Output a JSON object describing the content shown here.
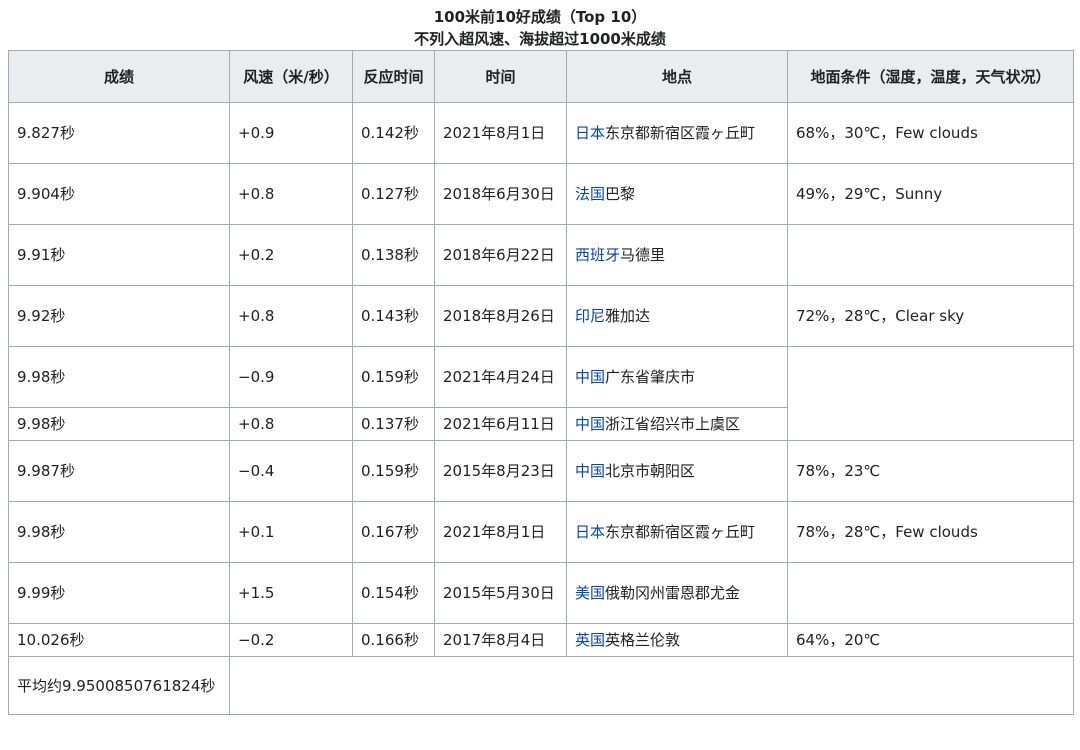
{
  "caption": {
    "line1": "100米前10好成绩（Top 10）",
    "line2": "不列入超风速、海拔超过1000米成绩"
  },
  "headers": {
    "score": "成绩",
    "wind": "风速（米/秒）",
    "reaction": "反应时间",
    "time": "时间",
    "location": "地点",
    "conditions": "地面条件（湿度，温度，天气状况）"
  },
  "rows": [
    {
      "score": "9.827秒",
      "wind": "+0.9",
      "reaction": "0.142秒",
      "date": "2021年8月1日",
      "country": "日本",
      "place": "东京都新宿区霞ヶ丘町",
      "cond": "68%，30℃，Few clouds"
    },
    {
      "score": "9.904秒",
      "wind": "+0.8",
      "reaction": "0.127秒",
      "date": "2018年6月30日",
      "country": "法国",
      "place": "巴黎",
      "cond": "49%，29℃，Sunny"
    },
    {
      "score": "9.91秒",
      "wind": "+0.2",
      "reaction": "0.138秒",
      "date": "2018年6月22日",
      "country": "西班牙",
      "place": "马德里",
      "cond": ""
    },
    {
      "score": "9.92秒",
      "wind": "+0.8",
      "reaction": "0.143秒",
      "date": "2018年8月26日",
      "country": "印尼",
      "place": "雅加达",
      "cond": "72%，28℃，Clear sky"
    },
    {
      "score": "9.98秒",
      "wind": "−0.9",
      "reaction": "0.159秒",
      "date": "2021年4月24日",
      "country": "中国",
      "place": "广东省肇庆市",
      "cond": ""
    },
    {
      "score": "9.98秒",
      "wind": "+0.8",
      "reaction": "0.137秒",
      "date": "2021年6月11日",
      "country": "中国",
      "place": "浙江省绍兴市上虞区"
    },
    {
      "score": "9.987秒",
      "wind": "−0.4",
      "reaction": "0.159秒",
      "date": "2015年8月23日",
      "country": "中国",
      "place": "北京市朝阳区",
      "cond": "78%，23℃"
    },
    {
      "score": "9.98秒",
      "wind": "+0.1",
      "reaction": "0.167秒",
      "date": "2021年8月1日",
      "country": "日本",
      "place": "东京都新宿区霞ヶ丘町",
      "cond": "78%，28℃，Few clouds"
    },
    {
      "score": "9.99秒",
      "wind": "+1.5",
      "reaction": "0.154秒",
      "date": "2015年5月30日",
      "country": "美国",
      "place": "俄勒冈州雷恩郡尤金",
      "cond": ""
    },
    {
      "score": "10.026秒",
      "wind": "−0.2",
      "reaction": "0.166秒",
      "date": "2017年8月4日",
      "country": "英国",
      "place": "英格兰伦敦",
      "cond": "64%，20℃"
    }
  ],
  "average": "平均约9.9500850761824秒",
  "colors": {
    "link": "#0645ad",
    "header_bg": "#eaecf0",
    "border": "#a2a9b1"
  }
}
